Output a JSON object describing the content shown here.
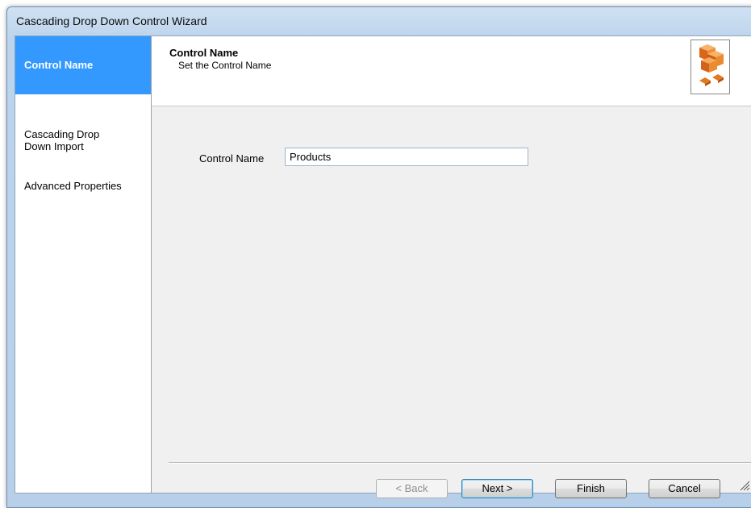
{
  "window": {
    "title": "Cascading Drop Down Control Wizard"
  },
  "sidebar": {
    "items": [
      {
        "label": "Control Name",
        "active": true
      },
      {
        "label": "Cascading Drop\nDown Import",
        "active": false
      },
      {
        "label": "Advanced Properties",
        "active": false
      }
    ]
  },
  "header": {
    "title": "Control Name",
    "subtitle": "Set the Control Name",
    "icon": "orange-cubes-icon"
  },
  "form": {
    "control_name_label": "Control Name",
    "control_name_value": "Products"
  },
  "buttons": {
    "back": "< Back",
    "next": "Next >",
    "finish": "Finish",
    "cancel": "Cancel"
  },
  "colors": {
    "selected_item": "#3399ff",
    "title_bar": "#bfd6ee",
    "dialog_bg": "#f0f0f0",
    "icon_orange": "#e07a1e"
  }
}
